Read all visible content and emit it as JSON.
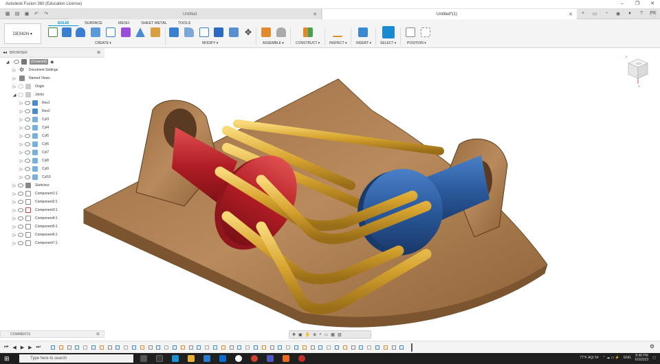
{
  "window": {
    "title": "Autodesk Fusion 360 (Education License)",
    "minimize": "–",
    "maximize": "❐",
    "close": "✕"
  },
  "tabs": [
    {
      "label": "Untitled",
      "close": "✕"
    },
    {
      "label": "Untitled*(1)",
      "close": "✕"
    }
  ],
  "quick_access": [
    "grid",
    "file",
    "save",
    "undo",
    "redo"
  ],
  "workspace": {
    "label": "DESIGN ▾"
  },
  "ribbon_tabs": [
    {
      "label": "SOLID",
      "active": true
    },
    {
      "label": "SURFACE"
    },
    {
      "label": "MESH"
    },
    {
      "label": "SHEET METAL"
    },
    {
      "label": "TOOLS"
    }
  ],
  "ribbon_groups": {
    "create": "CREATE ▾",
    "modify": "MODIFY ▾",
    "assemble": "ASSEMBLE ▾",
    "construct": "CONSTRUCT ▾",
    "inspect": "INSPECT ▾",
    "insert": "INSERT ▾",
    "select": "SELECT ▾",
    "position": "POSITION ▾"
  },
  "browser": {
    "title": "BROWSER",
    "items": [
      {
        "label": "(Unsaved)",
        "highlight": true
      },
      {
        "label": "Document Settings"
      },
      {
        "label": "Named Views"
      },
      {
        "label": "Origin"
      },
      {
        "label": "Joints"
      },
      {
        "label": "Rev1"
      },
      {
        "label": "Rev2"
      },
      {
        "label": "Cyl3"
      },
      {
        "label": "Cyl4"
      },
      {
        "label": "Cyl5"
      },
      {
        "label": "Cyl6"
      },
      {
        "label": "Cyl7"
      },
      {
        "label": "Cyl8"
      },
      {
        "label": "Cyl9"
      },
      {
        "label": "Cyl10"
      },
      {
        "label": "Sketches"
      },
      {
        "label": "Component1:1"
      },
      {
        "label": "Component2:1"
      },
      {
        "label": "Component3:1"
      },
      {
        "label": "Component4:1"
      },
      {
        "label": "Component5:1"
      },
      {
        "label": "Component6:1"
      },
      {
        "label": "Component7:1"
      }
    ]
  },
  "comments": {
    "title": "COMMENTS"
  },
  "viewcube": {
    "label": "TOP",
    "axis_x": "X",
    "axis_z": "Z"
  },
  "taskbar": {
    "search_placeholder": "Type here to search",
    "weather": "77°F AQI 54",
    "lang": "ENG",
    "time": "8:48 PM",
    "date": "6/3/2023"
  },
  "user": {
    "initials": "PK"
  },
  "colors": {
    "accent": "#0696d7",
    "wood": "#a87d52",
    "red": "#c0272d",
    "blue": "#2e5fa0",
    "brass": "#d8a530"
  }
}
